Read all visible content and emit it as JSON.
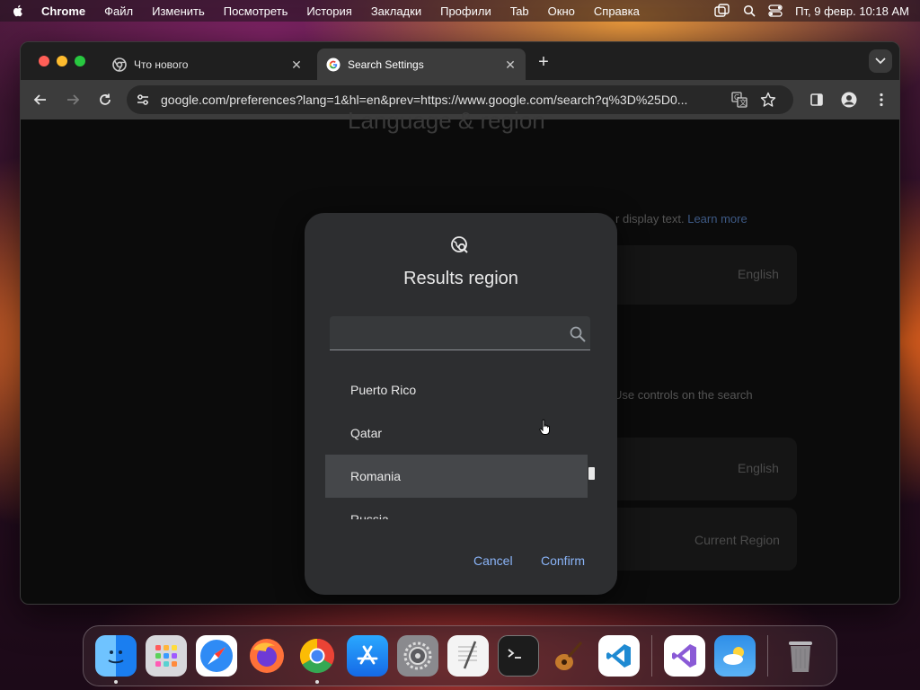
{
  "menubar": {
    "app_name": "Chrome",
    "items": [
      "Файл",
      "Изменить",
      "Посмотреть",
      "История",
      "Закладки",
      "Профили",
      "Tab",
      "Окно",
      "Справка"
    ],
    "datetime": "Пт, 9 февр.  10:18 AM"
  },
  "browser": {
    "tabs": [
      {
        "title": "Что нового",
        "icon": "chrome-icon",
        "active": false
      },
      {
        "title": "Search Settings",
        "icon": "google-icon",
        "active": true
      }
    ],
    "url": "google.com/preferences?lang=1&hl=en&prev=https://www.google.com/search?q%3D%25D0..."
  },
  "background_page": {
    "heading": "Language & region",
    "text_1": "r display text.",
    "link_1": "Learn more",
    "card_1_value": "English",
    "text_2": "Use controls on the search",
    "card_2_value": "English",
    "card_3_value": "Current Region"
  },
  "dialog": {
    "title": "Results region",
    "search_value": "",
    "search_placeholder": "",
    "items": [
      "Puerto Rico",
      "Qatar",
      "Romania",
      "Russia"
    ],
    "highlighted_item": "Romania",
    "cancel_label": "Cancel",
    "confirm_label": "Confirm"
  },
  "dock": {
    "apps": [
      "Finder",
      "Launchpad",
      "Safari",
      "Firefox",
      "Chrome",
      "App Store",
      "System Settings",
      "TextEdit",
      "Terminal",
      "GarageBand",
      "Visual Studio Code",
      "Visual Studio",
      "Weather",
      "Trash"
    ]
  },
  "colors": {
    "accent": "#8ab4f8",
    "dialog_bg": "#2d2e30",
    "page_bg": "#0b0b0b",
    "highlight_row": "#45474a"
  }
}
